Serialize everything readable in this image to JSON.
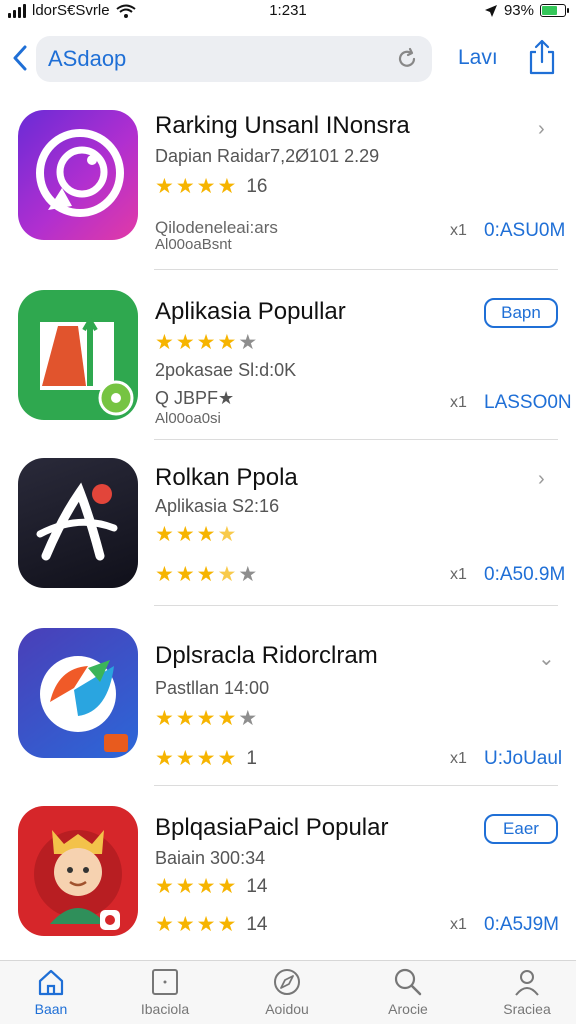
{
  "status_bar": {
    "carrier": "ldorS€Svrle",
    "time": "1:231",
    "battery": "93%"
  },
  "nav": {
    "search_text": "ASdaop",
    "right_link": "Lavı"
  },
  "apps": [
    {
      "title": "Rarking Unsanl INonsra",
      "subtitle": "Dapian Raidar7,2Ø101 2.29",
      "rating_count": "16",
      "extra1": "Qilodeneleai:ars",
      "extra2": "Al00oaBsnt",
      "multiplier": "x1",
      "size": "0:ASU0M",
      "action": "chevron"
    },
    {
      "title": "Aplikasia Popullar",
      "subtitle": "2pokasae Sl:d:0K",
      "button": "Bapn",
      "extra1": "Q JBPF★",
      "extra2": "Al00oa0si",
      "multiplier": "x1",
      "size": "LASSO0N",
      "action": "button"
    },
    {
      "title": "Rolkan Ppola",
      "subtitle": "Aplikasia S2:16",
      "multiplier": "x1",
      "size": "0:A50.9M",
      "action": "chevron"
    },
    {
      "title": "Dplsracla Ridorclram",
      "subtitle": "Pastllan 14:00",
      "rating_count": "1",
      "multiplier": "x1",
      "size": "U:JoUaul",
      "action": "chevron-down"
    },
    {
      "title": "BplqasiaPaicl Popular",
      "subtitle": "Baiain 300:34",
      "rating_count": "14",
      "rating_count2": "14",
      "button": "Eaer",
      "multiplier": "x1",
      "size": "0:A5J9M",
      "action": "button"
    }
  ],
  "tabs": [
    {
      "label": "Baan",
      "icon": "home-icon",
      "active": true
    },
    {
      "label": "Ibaciola",
      "icon": "square-icon",
      "active": false
    },
    {
      "label": "Aoidou",
      "icon": "compass-icon",
      "active": false
    },
    {
      "label": "Arocie",
      "icon": "search-icon",
      "active": false
    },
    {
      "label": "Sraciea",
      "icon": "person-icon",
      "active": false
    }
  ],
  "colors": {
    "accent": "#1f6fd6",
    "star": "#f6b400",
    "battery": "#34c759"
  }
}
